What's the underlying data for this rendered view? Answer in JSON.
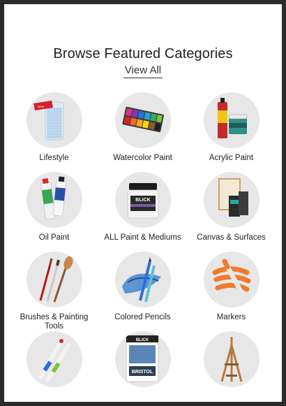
{
  "section": {
    "title": "Browse Featured Categories",
    "view_all_label": "View All"
  },
  "categories": [
    {
      "label": "Lifestyle",
      "icon": "candle-icon"
    },
    {
      "label": "Watercolor Paint",
      "icon": "watercolor-palette-icon"
    },
    {
      "label": "Acrylic Paint",
      "icon": "acrylic-paint-icon"
    },
    {
      "label": "Oil Paint",
      "icon": "oil-paint-tubes-icon"
    },
    {
      "label": "ALL Paint & Mediums",
      "icon": "paint-jar-icon",
      "jar_brand": "BLICK"
    },
    {
      "label": "Canvas & Surfaces",
      "icon": "canvas-panels-icon"
    },
    {
      "label": "Brushes & Painting Tools",
      "icon": "paintbrushes-icon"
    },
    {
      "label": "Colored Pencils",
      "icon": "colored-pencils-icon"
    },
    {
      "label": "Markers",
      "icon": "marker-icon"
    },
    {
      "label": "",
      "icon": "markers-set-icon"
    },
    {
      "label": "",
      "icon": "bristol-pad-icon",
      "pad_brand": "BLICK",
      "pad_title": "BRISTOL"
    },
    {
      "label": "",
      "icon": "easel-icon"
    }
  ]
}
